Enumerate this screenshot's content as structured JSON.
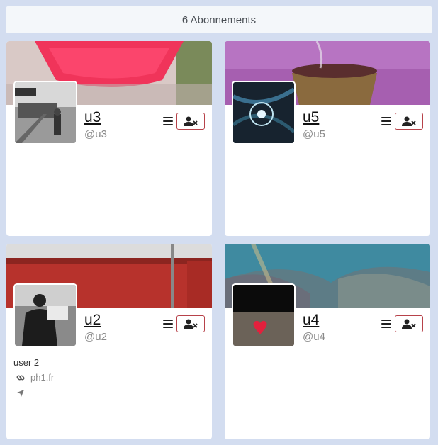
{
  "header": {
    "title": "6 Abonnements"
  },
  "cards": [
    {
      "name": "u3",
      "handle": "@u3",
      "bio": "",
      "link": ""
    },
    {
      "name": "u5",
      "handle": "@u5",
      "bio": "",
      "link": ""
    },
    {
      "name": "u2",
      "handle": "@u2",
      "bio": "user 2",
      "link": "ph1.fr"
    },
    {
      "name": "u4",
      "handle": "@u4",
      "bio": "",
      "link": ""
    }
  ],
  "icons": {
    "menu": "hamburger-menu-icon",
    "unfollow": "user-remove-icon",
    "link": "link-icon",
    "location": "location-arrow-icon"
  },
  "colors": {
    "page_bg": "#d3ddf0",
    "unfollow_border": "#b7424a",
    "muted_text": "#8a8a8a"
  }
}
